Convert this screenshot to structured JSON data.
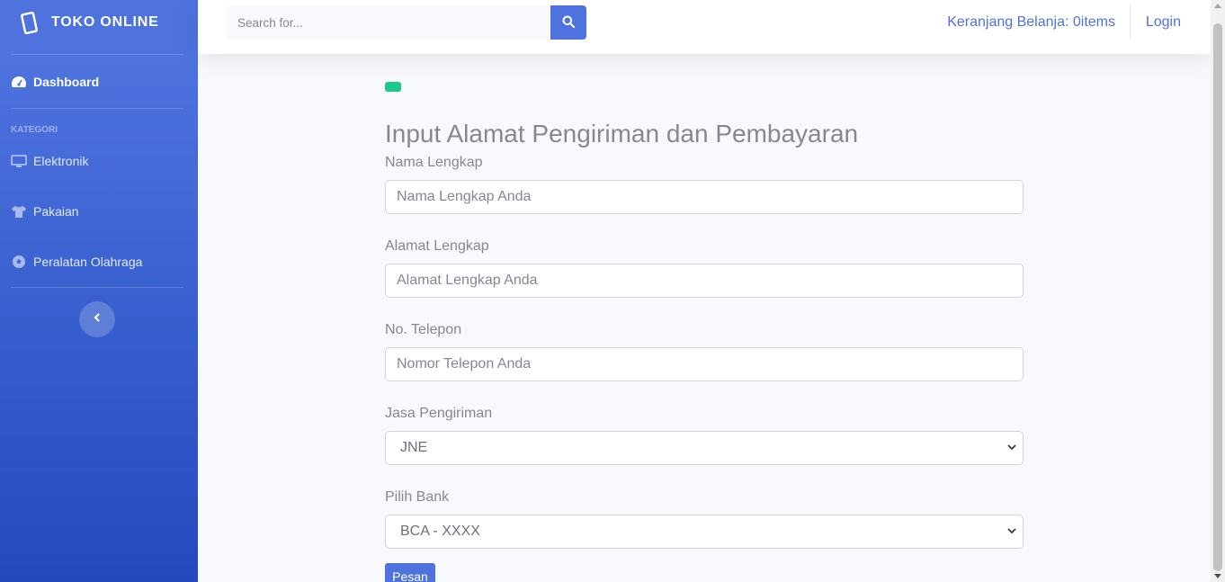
{
  "brand": {
    "name": "TOKO ONLINE",
    "icon": "tablet-icon"
  },
  "sidebar": {
    "dashboard": {
      "label": "Dashboard",
      "icon": "dashboard-gauge-icon"
    },
    "category_heading": "KATEGORI",
    "items": [
      {
        "label": "Elektronik",
        "icon": "desktop-icon"
      },
      {
        "label": "Pakaian",
        "icon": "tshirt-icon"
      },
      {
        "label": "Peralatan Olahraga",
        "icon": "football-icon"
      }
    ],
    "toggle_icon": "chevron-left-icon"
  },
  "topbar": {
    "search_placeholder": "Search for...",
    "search_icon": "search-icon",
    "cart_label": "Keranjang Belanja: 0items",
    "login_label": "Login"
  },
  "form": {
    "title": "Input Alamat Pengiriman dan Pembayaran",
    "fields": [
      {
        "label": "Nama Lengkap",
        "placeholder": "Nama Lengkap Anda"
      },
      {
        "label": "Alamat Lengkap",
        "placeholder": "Alamat Lengkap Anda"
      },
      {
        "label": "No. Telepon",
        "placeholder": "Nomor Telepon Anda"
      }
    ],
    "shipping": {
      "label": "Jasa Pengiriman",
      "selected": "JNE"
    },
    "bank": {
      "label": "Pilih Bank",
      "selected": "BCA - XXXX"
    },
    "submit_label": "Pesan"
  },
  "colors": {
    "primary": "#4e73df",
    "success": "#1cc88a",
    "text_muted": "#858796"
  }
}
